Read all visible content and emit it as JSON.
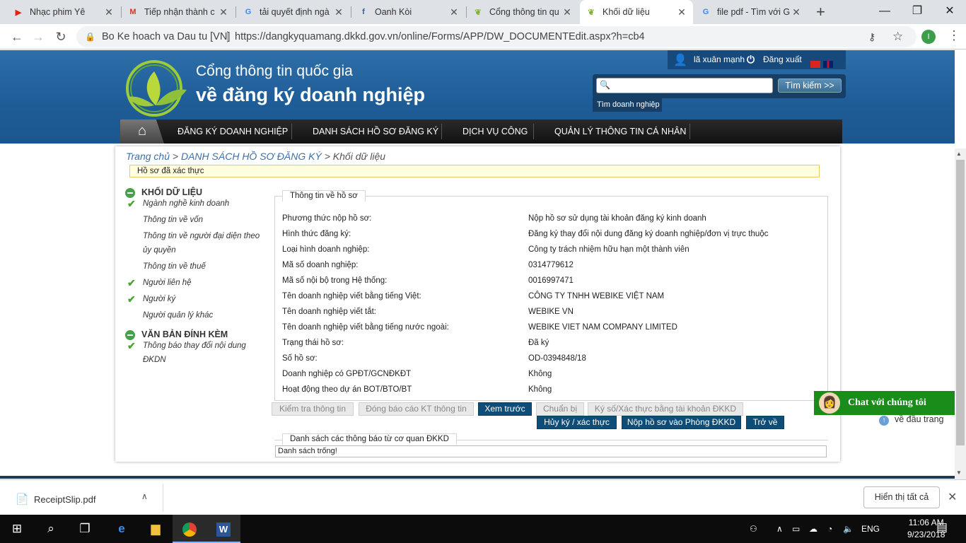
{
  "browser": {
    "tabs": [
      {
        "title": "Nhạc phim Yê",
        "icon": "youtube-icon",
        "color": "#e62117"
      },
      {
        "title": "Tiếp nhận thành c",
        "icon": "gmail-icon",
        "color": "#d93025"
      },
      {
        "title": "tải quyết định ngà",
        "icon": "google-icon",
        "color": "#4285f4"
      },
      {
        "title": "Oanh Kòi",
        "icon": "facebook-icon",
        "color": "#3b5998"
      },
      {
        "title": "Cổng thông tin qu",
        "icon": "leaf-icon",
        "color": "#7fb03a"
      },
      {
        "title": "Khối dữ liệu",
        "icon": "leaf-icon",
        "color": "#7fb03a"
      },
      {
        "title": "file pdf - Tìm với G",
        "icon": "google-icon",
        "color": "#4285f4"
      }
    ],
    "org_label": "Bo Ke hoach va Dau tu [VN]",
    "url": "https://dangkyquamang.dkkd.gov.vn/online/Forms/APP/DW_DOCUMENTEdit.aspx?h=cb4",
    "profile_initial": "I"
  },
  "site": {
    "title_line1": "Cổng thông tin quốc gia",
    "title_line2": "về đăng ký doanh nghiệp",
    "user_name": "lã xuân mạnh",
    "logout_label": "Đăng xuất",
    "search_button": "Tìm kiếm >>",
    "search_tag": "Tìm doanh nghiệp",
    "nav": [
      "ĐĂNG KÝ DOANH NGHIỆP",
      "DANH SÁCH HỒ SƠ ĐĂNG KÝ",
      "DỊCH VỤ CÔNG",
      "QUẢN LÝ THÔNG TIN CÁ NHÂN"
    ]
  },
  "breadcrumb": {
    "home": "Trang chủ",
    "sep": " > ",
    "list": "DANH SÁCH HỒ SƠ ĐĂNG KÝ",
    "current": "Khối dữ liệu"
  },
  "verified_notice": "Hồ sơ đã xác thực",
  "sidebar": {
    "group1": "KHỐI DỮ LIỆU",
    "group2": "VĂN BẢN ĐÍNH KÈM",
    "items": [
      {
        "label": "Ngành nghề kinh doanh",
        "checked": true
      },
      {
        "label": "Thông tin về vốn",
        "checked": false
      },
      {
        "label": "Thông tin về người đại diện theo ủy quyền",
        "checked": false
      },
      {
        "label": "Thông tin về thuế",
        "checked": false
      },
      {
        "label": "Người liên hệ",
        "checked": true
      },
      {
        "label": "Người ký",
        "checked": true
      },
      {
        "label": "Người quản lý khác",
        "checked": false
      }
    ],
    "attachments": [
      {
        "label": "Thông báo thay đổi nội dung ĐKDN",
        "checked": true
      }
    ]
  },
  "info": {
    "legend": "Thông tin về hồ sơ",
    "rows": [
      {
        "label": "Phương thức nộp hồ sơ:",
        "value": "Nộp hồ sơ sử dụng tài khoản đăng ký kinh doanh"
      },
      {
        "label": "Hình thức đăng ký:",
        "value": "Đăng ký thay đổi nội dung đăng ký doanh nghiệp/đơn vị trực thuộc"
      },
      {
        "label": "Loại hình doanh nghiệp:",
        "value": "Công ty trách nhiệm hữu hạn một thành viên"
      },
      {
        "label": "Mã số doanh nghiệp:",
        "value": "0314779612"
      },
      {
        "label": "Mã số nội bộ trong Hệ thống:",
        "value": "0016997471"
      },
      {
        "label": "Tên doanh nghiệp viết bằng tiếng Việt:",
        "value": "CÔNG TY TNHH WEBIKE VIỆT NAM"
      },
      {
        "label": "Tên doanh nghiệp viết tắt:",
        "value": "WEBIKE VN"
      },
      {
        "label": "Tên doanh nghiệp viết bằng tiếng nước ngoài:",
        "value": "WEBIKE VIET NAM COMPANY LIMITED"
      },
      {
        "label": "Trạng thái hồ sơ:",
        "value": "Đã ký"
      },
      {
        "label": "Số hồ sơ:",
        "value": "OD-0394848/18"
      },
      {
        "label": "Doanh nghiệp có GPĐT/GCNĐKĐT",
        "value": "Không"
      },
      {
        "label": "Hoạt động theo dự án BOT/BTO/BT",
        "value": "Không"
      }
    ]
  },
  "buttons": {
    "check": "Kiểm tra thông tin",
    "close_kt": "Đóng báo cáo KT thông tin",
    "preview": "Xem trước",
    "prepare": "Chuẩn bị",
    "sign": "Ký số/Xác thực bằng tài khoản ĐKKD",
    "cancel_sign": "Hủy ký / xác thực",
    "submit": "Nộp hồ sơ vào Phòng ĐKKD",
    "back": "Trở về"
  },
  "notices": {
    "legend": "Danh sách các thông báo từ cơ quan ĐKKD",
    "empty": "Danh sách trống!"
  },
  "chat_label": "Chat với chúng tôi",
  "to_top": "về đầu trang",
  "downloads": {
    "file": "ReceiptSlip.pdf",
    "show_all": "Hiển thị tất cả"
  },
  "taskbar": {
    "lang": "ENG",
    "time": "11:06 AM",
    "date": "9/23/2018"
  }
}
